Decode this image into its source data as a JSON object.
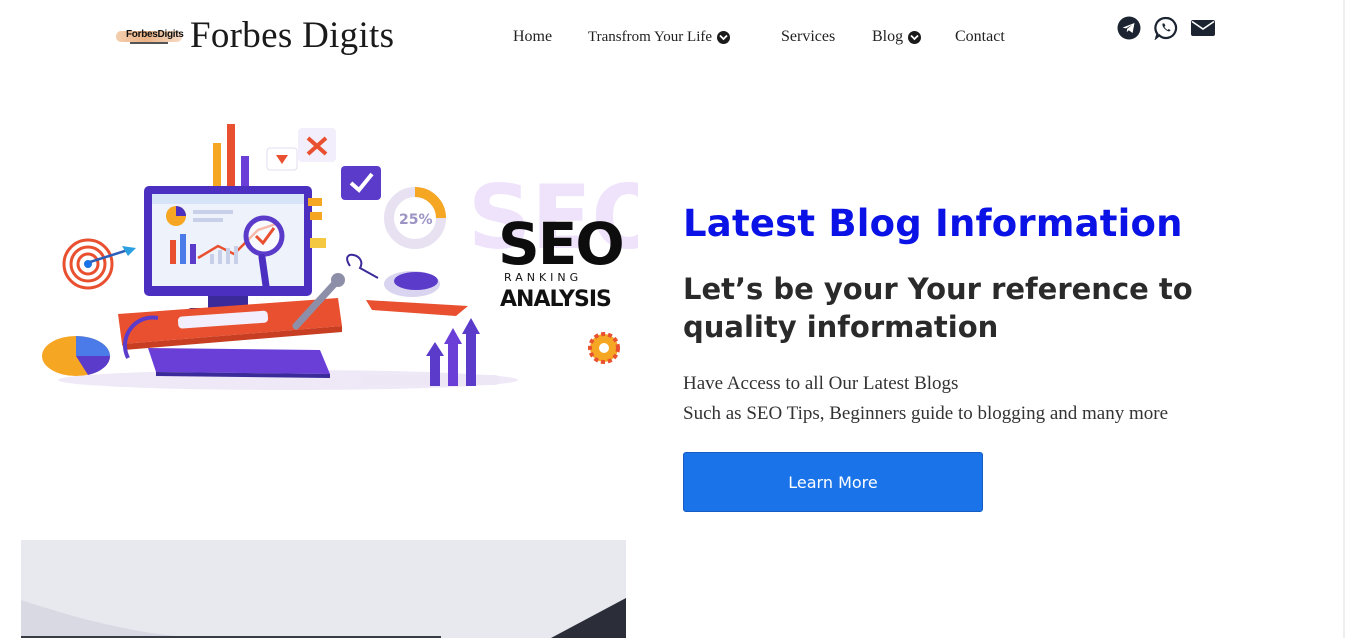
{
  "brand": {
    "logo_text": "ForbesDigits",
    "name": "Forbes Digits"
  },
  "nav": {
    "home": "Home",
    "transform": "Transfrom Your Life",
    "services": "Services",
    "blog": "Blog",
    "contact": "Contact"
  },
  "social": {
    "icons": [
      "telegram-icon",
      "whatsapp-icon",
      "envelope-icon"
    ]
  },
  "illustration": {
    "seo": "SEO",
    "ranking": "RANKING",
    "analysis": "ANALYSIS",
    "percent": "25%"
  },
  "hero": {
    "title": "Latest Blog Information",
    "subtitle": "Let’s be your Your reference to quality information",
    "line1": "Have Access to all Our Latest Blogs",
    "line2": "Such as SEO Tips, Beginners guide to blogging and many more",
    "button": "Learn More"
  },
  "colors": {
    "title_blue": "#0b12e6",
    "button_blue": "#1a73e8"
  }
}
